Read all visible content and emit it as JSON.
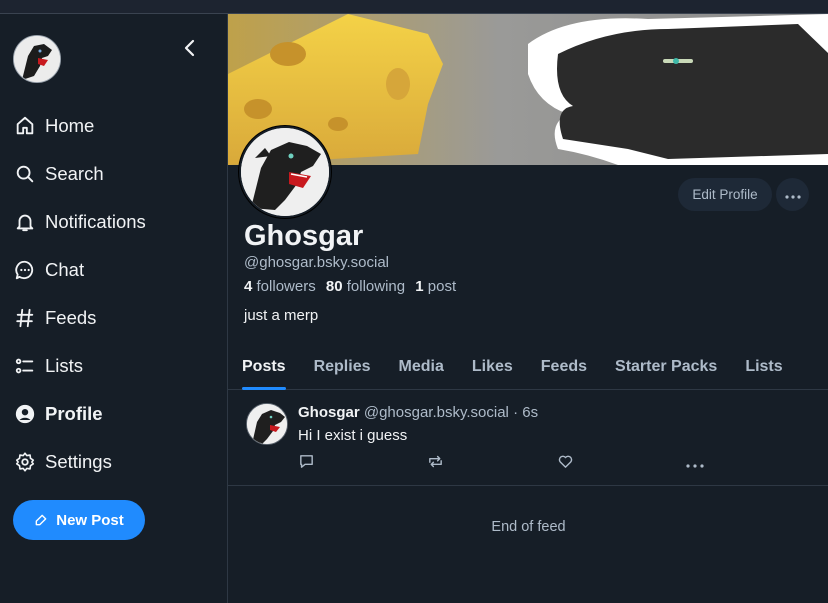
{
  "sidebar": {
    "items": [
      {
        "label": "Home",
        "icon": "home-icon"
      },
      {
        "label": "Search",
        "icon": "search-icon"
      },
      {
        "label": "Notifications",
        "icon": "bell-icon"
      },
      {
        "label": "Chat",
        "icon": "chat-icon"
      },
      {
        "label": "Feeds",
        "icon": "hash-icon"
      },
      {
        "label": "Lists",
        "icon": "list-icon"
      },
      {
        "label": "Profile",
        "icon": "profile-icon"
      },
      {
        "label": "Settings",
        "icon": "gear-icon"
      }
    ],
    "active": "Profile",
    "new_post_label": "New Post"
  },
  "profile": {
    "display_name": "Ghosgar",
    "handle": "@ghosgar.bsky.social",
    "followers_count": "4",
    "followers_label": "followers",
    "following_count": "80",
    "following_label": "following",
    "posts_count": "1",
    "posts_label": "post",
    "bio": "just a merp",
    "edit_label": "Edit Profile"
  },
  "tabs": [
    {
      "label": "Posts",
      "active": true
    },
    {
      "label": "Replies"
    },
    {
      "label": "Media"
    },
    {
      "label": "Likes"
    },
    {
      "label": "Feeds"
    },
    {
      "label": "Starter Packs"
    },
    {
      "label": "Lists"
    }
  ],
  "post": {
    "author": "Ghosgar",
    "handle": "@ghosgar.bsky.social",
    "time": "· 6s",
    "text": "Hi I exist i guess"
  },
  "feed_end_label": "End of feed",
  "colors": {
    "background": "#161e27",
    "accent": "#208bfe",
    "muted_text": "#aebbc9",
    "text": "#f1f3f5"
  }
}
